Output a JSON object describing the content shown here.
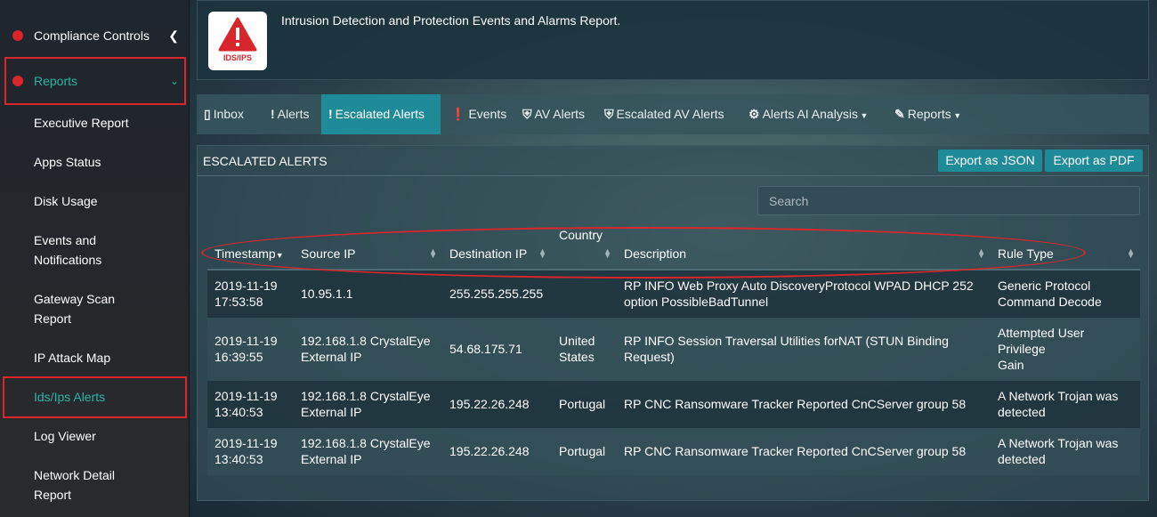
{
  "sidebar": {
    "compliance": "Compliance Controls",
    "reports": "Reports",
    "items": [
      {
        "label": "Executive Report"
      },
      {
        "label": "Apps Status"
      },
      {
        "label": "Disk Usage"
      },
      {
        "label": "Events and\nNotifications"
      },
      {
        "label": "Gateway Scan\nReport"
      },
      {
        "label": "IP Attack Map"
      },
      {
        "label": "Ids/Ips Alerts"
      },
      {
        "label": "Log Viewer"
      },
      {
        "label": "Network Detail\nReport"
      }
    ]
  },
  "header": {
    "logo_text": "IDS/IPS",
    "title": "Intrusion Detection and Protection Events and Alarms Report."
  },
  "tabs": [
    {
      "icon": "inbox-icon",
      "label": "Inbox"
    },
    {
      "icon": "exclamation-icon",
      "label": "Alerts"
    },
    {
      "icon": "exclamation-icon",
      "label": "Escalated Alerts"
    },
    {
      "icon": "exclamation-circle-icon",
      "label": "Events"
    },
    {
      "icon": "shield-icon",
      "label": "AV Alerts"
    },
    {
      "icon": "shield-icon",
      "label": "Escalated AV Alerts"
    },
    {
      "icon": "gear-icon",
      "label": "Alerts AI Analysis"
    },
    {
      "icon": "pencil-icon",
      "label": "Reports"
    }
  ],
  "panel": {
    "title": "ESCALATED ALERTS",
    "export_json": "Export as JSON",
    "export_pdf": "Export as PDF",
    "search_placeholder": "Search"
  },
  "table": {
    "headers": [
      "Timestamp",
      "Source IP",
      "Destination IP",
      "Country",
      "Description",
      "Rule Type"
    ],
    "rows": [
      [
        "2019-11-19\n17:53:58",
        "10.95.1.1",
        "255.255.255.255",
        "",
        "RP INFO Web Proxy Auto DiscoveryProtocol WPAD DHCP 252\noption PossibleBadTunnel",
        "Generic Protocol\nCommand Decode"
      ],
      [
        "2019-11-19\n16:39:55",
        "192.168.1.8 CrystalEye\nExternal IP",
        "54.68.175.71",
        "United\nStates",
        "RP INFO Session Traversal Utilities forNAT (STUN Binding Request)",
        "Attempted User Privilege\nGain"
      ],
      [
        "2019-11-19\n13:40:53",
        "192.168.1.8 CrystalEye\nExternal IP",
        "195.22.26.248",
        "Portugal",
        "RP CNC Ransomware Tracker Reported CnCServer group 58",
        "A Network Trojan was\ndetected"
      ],
      [
        "2019-11-19\n13:40:53",
        "192.168.1.8 CrystalEye\nExternal IP",
        "195.22.26.248",
        "Portugal",
        "RP CNC Ransomware Tracker Reported CnCServer group 58",
        "A Network Trojan was\ndetected"
      ]
    ]
  },
  "colors": {
    "accent": "#1f8b98",
    "highlight": "#d9262c",
    "active_text": "#2ab3a4"
  }
}
